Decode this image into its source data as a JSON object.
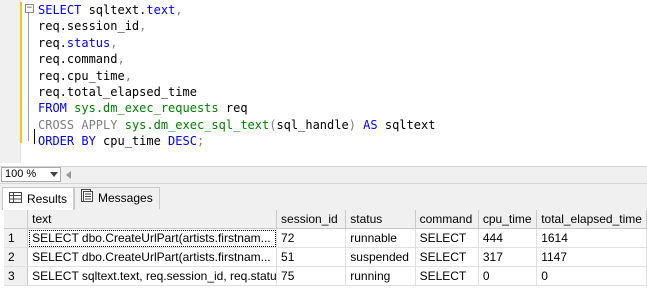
{
  "editor": {
    "lines": [
      {
        "parts": [
          {
            "t": "SELECT",
            "c": "kw"
          },
          {
            "t": " sqltext.",
            "c": ""
          },
          {
            "t": "text",
            "c": "kw"
          },
          {
            "t": ",",
            "c": "gray"
          }
        ]
      },
      {
        "parts": [
          {
            "t": "req.session_id",
            "c": ""
          },
          {
            "t": ",",
            "c": "gray"
          }
        ]
      },
      {
        "parts": [
          {
            "t": "req.",
            "c": ""
          },
          {
            "t": "status",
            "c": "kw"
          },
          {
            "t": ",",
            "c": "gray"
          }
        ]
      },
      {
        "parts": [
          {
            "t": "req.command",
            "c": ""
          },
          {
            "t": ",",
            "c": "gray"
          }
        ]
      },
      {
        "parts": [
          {
            "t": "req.cpu_time",
            "c": ""
          },
          {
            "t": ",",
            "c": "gray"
          }
        ]
      },
      {
        "parts": [
          {
            "t": "req.total_elapsed_time",
            "c": ""
          }
        ]
      },
      {
        "parts": [
          {
            "t": "FROM",
            "c": "kw"
          },
          {
            "t": " ",
            "c": ""
          },
          {
            "t": "sys.dm_exec_requests",
            "c": "sys"
          },
          {
            "t": " req",
            "c": ""
          }
        ]
      },
      {
        "parts": [
          {
            "t": "CROSS APPLY",
            "c": "gray"
          },
          {
            "t": " ",
            "c": ""
          },
          {
            "t": "sys.dm_exec_sql_text",
            "c": "sys"
          },
          {
            "t": "(",
            "c": "gray"
          },
          {
            "t": "sql_handle",
            "c": ""
          },
          {
            "t": ")",
            "c": "gray"
          },
          {
            "t": " ",
            "c": ""
          },
          {
            "t": "AS",
            "c": "kw"
          },
          {
            "t": " sqltext",
            "c": ""
          }
        ]
      },
      {
        "parts": [
          {
            "t": "ORDER BY",
            "c": "kw"
          },
          {
            "t": " cpu_time ",
            "c": ""
          },
          {
            "t": "DESC",
            "c": "kw"
          },
          {
            "t": ";",
            "c": "gray"
          }
        ]
      }
    ]
  },
  "zoom": {
    "value": "100 %"
  },
  "tabs": [
    {
      "label": "Results",
      "icon": "grid-icon",
      "active": true
    },
    {
      "label": "Messages",
      "icon": "messages-icon",
      "active": false
    }
  ],
  "results": {
    "columns": [
      "",
      "text",
      "session_id",
      "status",
      "command",
      "cpu_time",
      "total_elapsed_time"
    ],
    "rows": [
      [
        "1",
        "SELECT         dbo.CreateUrlPart(artists.firstnam...",
        "72",
        "runnable",
        "SELECT",
        "444",
        "1614"
      ],
      [
        "2",
        "SELECT         dbo.CreateUrlPart(artists.firstnam...",
        "51",
        "suspended",
        "SELECT",
        "317",
        "1147"
      ],
      [
        "3",
        "SELECT sqltext.text,  req.session_id,  req.statu...",
        "75",
        "running",
        "SELECT",
        "0",
        "0"
      ]
    ]
  }
}
